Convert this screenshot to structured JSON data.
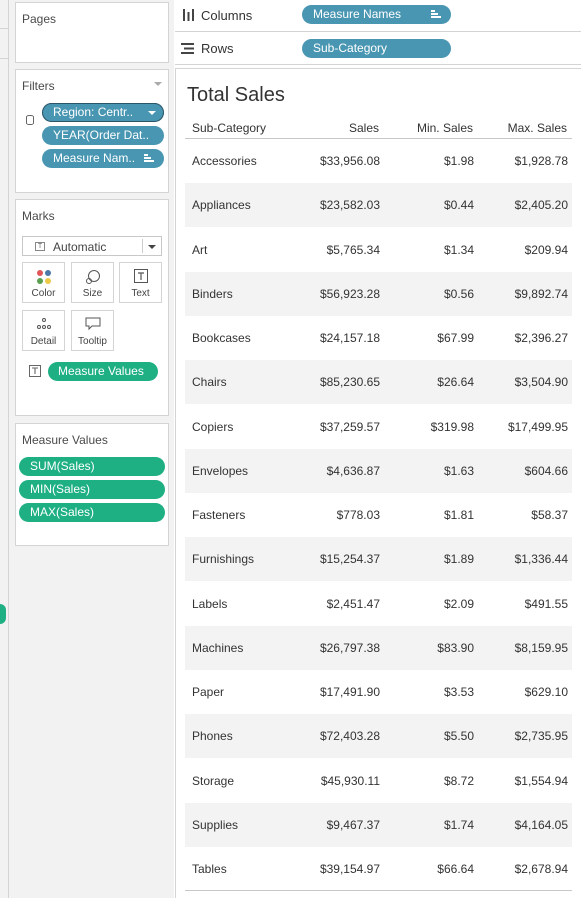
{
  "cards": {
    "pages": {
      "title": "Pages"
    },
    "filters": {
      "title": "Filters",
      "pills": [
        "Region: Centr..",
        "YEAR(Order Dat..",
        "Measure Nam.."
      ]
    },
    "marks": {
      "title": "Marks",
      "mark_type": "Automatic",
      "buttons": [
        "Color",
        "Size",
        "Text",
        "Detail",
        "Tooltip"
      ],
      "text_pill": "Measure Values"
    },
    "measure_values": {
      "title": "Measure Values",
      "pills": [
        "SUM(Sales)",
        "MIN(Sales)",
        "MAX(Sales)"
      ]
    }
  },
  "shelves": {
    "columns": {
      "label": "Columns",
      "pill": "Measure Names"
    },
    "rows": {
      "label": "Rows",
      "pill": "Sub-Category"
    }
  },
  "view": {
    "title": "Total Sales",
    "headers": [
      "Sub-Category",
      "Sales",
      "Min. Sales",
      "Max. Sales"
    ],
    "rows": [
      [
        "Accessories",
        "$33,956.08",
        "$1.98",
        "$1,928.78"
      ],
      [
        "Appliances",
        "$23,582.03",
        "$0.44",
        "$2,405.20"
      ],
      [
        "Art",
        "$5,765.34",
        "$1.34",
        "$209.94"
      ],
      [
        "Binders",
        "$56,923.28",
        "$0.56",
        "$9,892.74"
      ],
      [
        "Bookcases",
        "$24,157.18",
        "$67.99",
        "$2,396.27"
      ],
      [
        "Chairs",
        "$85,230.65",
        "$26.64",
        "$3,504.90"
      ],
      [
        "Copiers",
        "$37,259.57",
        "$319.98",
        "$17,499.95"
      ],
      [
        "Envelopes",
        "$4,636.87",
        "$1.63",
        "$604.66"
      ],
      [
        "Fasteners",
        "$778.03",
        "$1.81",
        "$58.37"
      ],
      [
        "Furnishings",
        "$15,254.37",
        "$1.89",
        "$1,336.44"
      ],
      [
        "Labels",
        "$2,451.47",
        "$2.09",
        "$491.55"
      ],
      [
        "Machines",
        "$26,797.38",
        "$83.90",
        "$8,159.95"
      ],
      [
        "Paper",
        "$17,491.90",
        "$3.53",
        "$629.10"
      ],
      [
        "Phones",
        "$72,403.28",
        "$5.50",
        "$2,735.95"
      ],
      [
        "Storage",
        "$45,930.11",
        "$8.72",
        "$1,554.94"
      ],
      [
        "Supplies",
        "$9,467.37",
        "$1.74",
        "$4,164.05"
      ],
      [
        "Tables",
        "$39,154.97",
        "$66.64",
        "$2,678.94"
      ]
    ]
  },
  "colors": {
    "dimension_pill": "#4996b2",
    "measure_pill": "#1eaf83",
    "panel_bg": "#f2f2f2",
    "band_row": "#f3f3f3"
  },
  "icons": {
    "columns": "columns-icon",
    "rows": "rows-icon",
    "sort": "sort-icon",
    "dropdown": "dropdown-caret-icon",
    "color": "color-dots-icon",
    "size": "size-icon",
    "text": "text-icon",
    "detail": "detail-icon",
    "tooltip": "tooltip-icon",
    "data_source": "database-icon"
  }
}
